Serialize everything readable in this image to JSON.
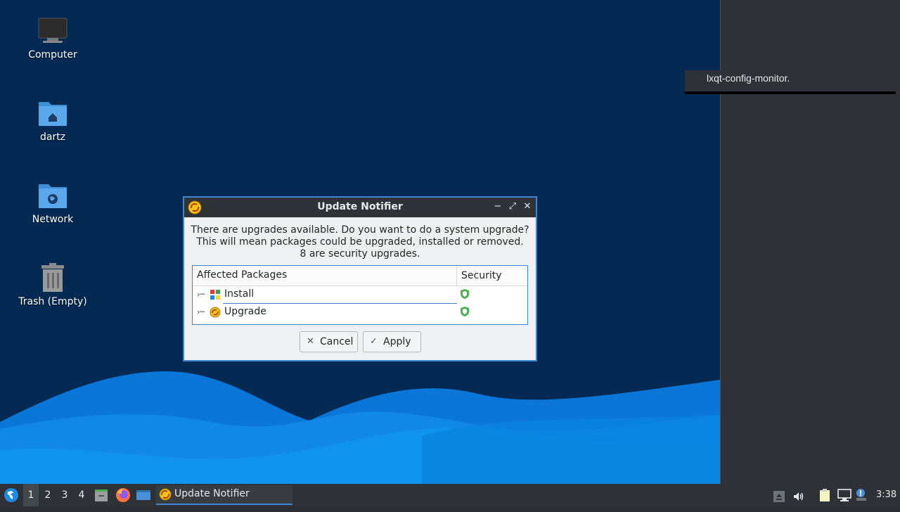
{
  "desktop": {
    "icons": [
      {
        "label": "Computer"
      },
      {
        "label": "dartz"
      },
      {
        "label": "Network"
      },
      {
        "label": "Trash (Empty)"
      }
    ],
    "notification_text": "lxqt-config-monitor."
  },
  "dialog": {
    "title": "Update Notifier",
    "message_line1": "There are upgrades available. Do you want to do a system upgrade?",
    "message_line2": "This will mean packages could be upgraded, installed or removed.",
    "message_line3": "8 are security upgrades.",
    "table": {
      "col_packages": "Affected Packages",
      "col_security": "Security",
      "rows": [
        {
          "name": "Install",
          "icon": "install-icon",
          "security": "shield-icon"
        },
        {
          "name": "Upgrade",
          "icon": "upgrade-icon",
          "security": "shield-icon"
        }
      ]
    },
    "cancel_label": "Cancel",
    "apply_label": "Apply"
  },
  "taskbar": {
    "workspaces": [
      "1",
      "2",
      "3",
      "4"
    ],
    "active_workspace": "1",
    "task_label": "Update Notifier",
    "clock": "3:38"
  },
  "colors": {
    "accent": "#3e86d0",
    "desktop_bg": "#042a54",
    "panel_bg": "#2e3136",
    "shield_green": "#4caf50"
  }
}
